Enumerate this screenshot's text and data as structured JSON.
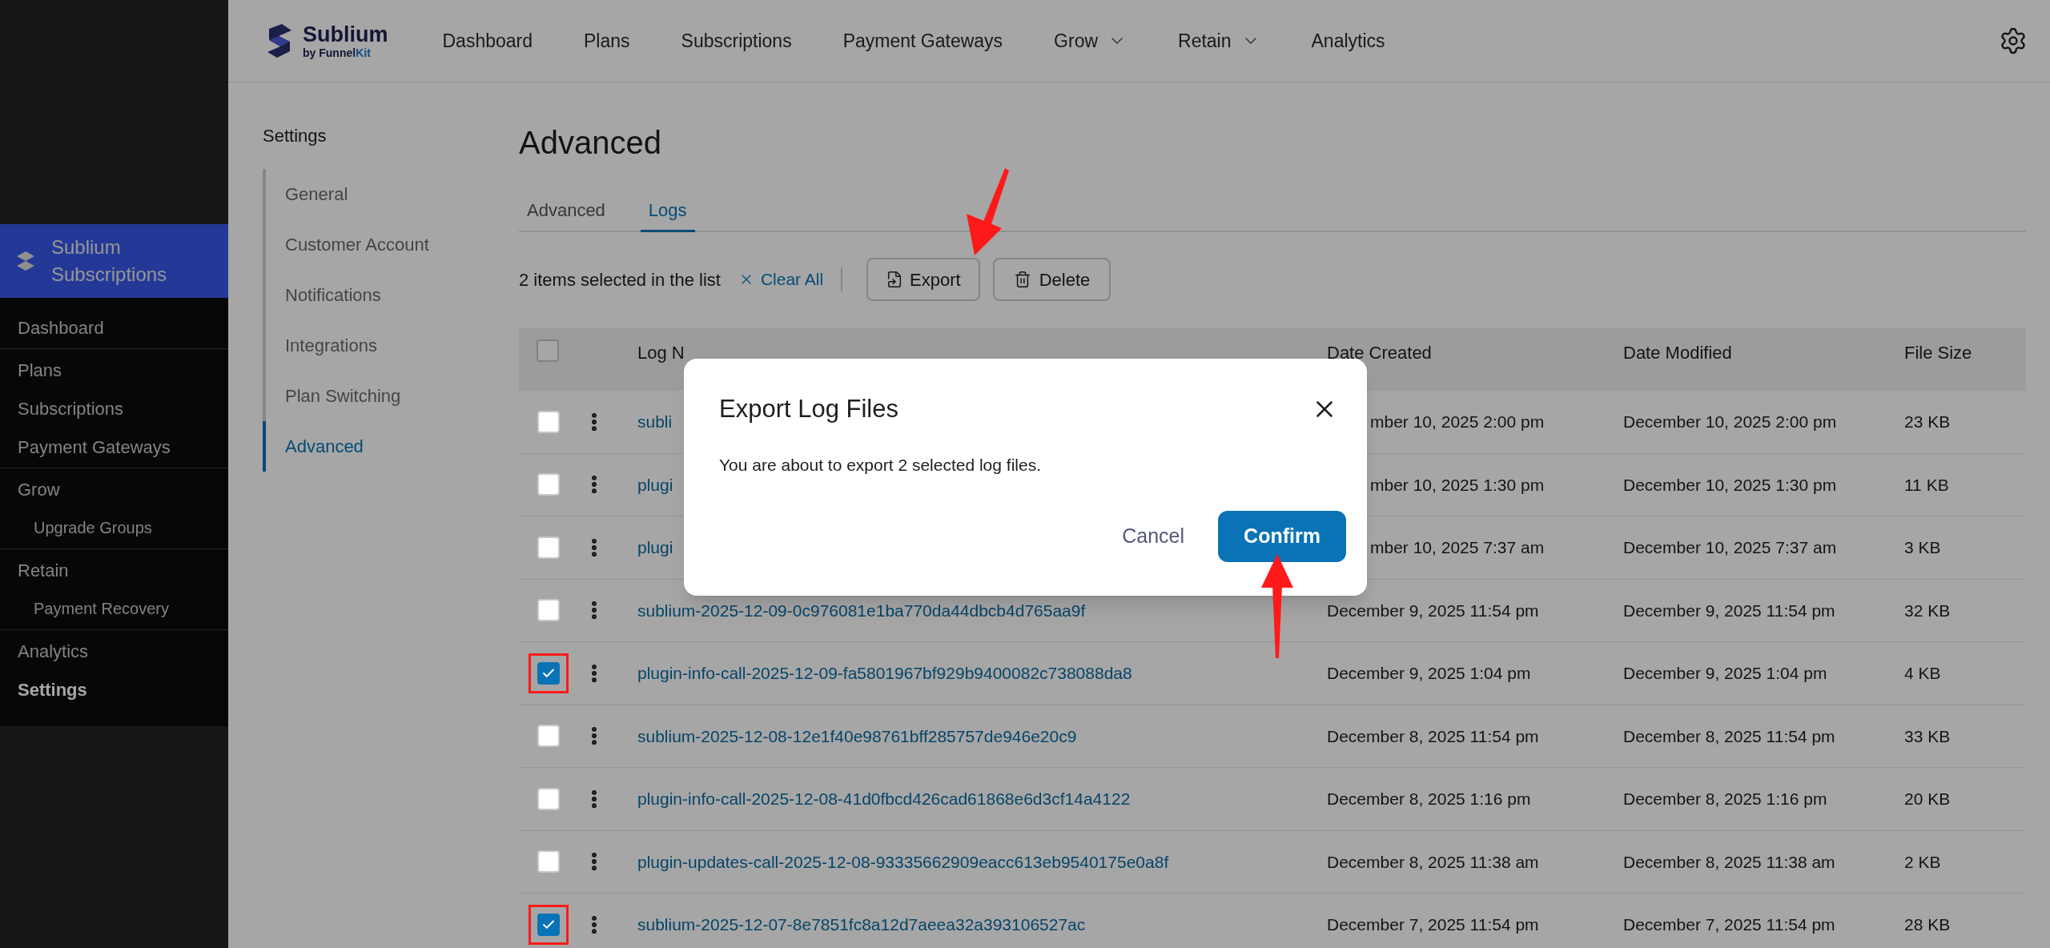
{
  "admin_menu": {
    "app": {
      "title": "Sublium Subscriptions",
      "selected": true
    },
    "groups": [
      [
        {
          "label": "Dashboard",
          "selected": false
        }
      ],
      [
        {
          "label": "Plans",
          "selected": false
        },
        {
          "label": "Subscriptions",
          "selected": false
        },
        {
          "label": "Payment Gateways",
          "selected": false
        }
      ],
      [
        {
          "label": "Grow",
          "selected": false,
          "children": [
            {
              "label": "Upgrade Groups",
              "selected": false
            }
          ]
        }
      ],
      [
        {
          "label": "Retain",
          "selected": false,
          "children": [
            {
              "label": "Payment Recovery",
              "selected": false
            }
          ]
        }
      ],
      [
        {
          "label": "Analytics",
          "selected": false
        },
        {
          "label": "Settings",
          "selected": true
        }
      ]
    ]
  },
  "top_bar": {
    "logo": {
      "name": "Sublium",
      "by": "by",
      "brand_first": "Funnel",
      "brand_second": "Kit"
    },
    "nav": [
      {
        "label": "Dashboard",
        "dropdown": false
      },
      {
        "label": "Plans",
        "dropdown": false
      },
      {
        "label": "Subscriptions",
        "dropdown": false
      },
      {
        "label": "Payment Gateways",
        "dropdown": false
      },
      {
        "label": "Grow",
        "dropdown": true
      },
      {
        "label": "Retain",
        "dropdown": true
      },
      {
        "label": "Analytics",
        "dropdown": false
      }
    ]
  },
  "settings_nav": {
    "title": "Settings",
    "items": [
      {
        "label": "General",
        "selected": false
      },
      {
        "label": "Customer Account",
        "selected": false
      },
      {
        "label": "Notifications",
        "selected": false
      },
      {
        "label": "Integrations",
        "selected": false
      },
      {
        "label": "Plan Switching",
        "selected": false
      },
      {
        "label": "Advanced",
        "selected": true
      }
    ]
  },
  "page_title": "Advanced",
  "tabs": [
    {
      "label": "Advanced",
      "selected": false
    },
    {
      "label": "Logs",
      "selected": true
    }
  ],
  "bulk_bar": {
    "text": "2 items selected in the list",
    "clear": "Clear All",
    "export": "Export",
    "delete": "Delete"
  },
  "table": {
    "select_all": false,
    "columns": [
      "Log N",
      "Date Created",
      "Date Modified",
      "File Size"
    ],
    "rows": [
      {
        "checked": false,
        "highlighted": false,
        "name": "subli",
        "created": "mber 10, 2025 2:00 pm",
        "modified": "December 10, 2025 2:00 pm",
        "size": "23 KB"
      },
      {
        "checked": false,
        "highlighted": false,
        "name": "plugi",
        "created": "mber 10, 2025 1:30 pm",
        "modified": "December 10, 2025 1:30 pm",
        "size": "11 KB"
      },
      {
        "checked": false,
        "highlighted": false,
        "name": "plugi",
        "created": "mber 10, 2025 7:37 am",
        "modified": "December 10, 2025 7:37 am",
        "size": "3 KB"
      },
      {
        "checked": false,
        "highlighted": false,
        "name": "sublium-2025-12-09-0c976081e1ba770da44dbcb4d765aa9f",
        "created": "December 9, 2025 11:54 pm",
        "modified": "December 9, 2025 11:54 pm",
        "size": "32 KB"
      },
      {
        "checked": true,
        "highlighted": true,
        "name": "plugin-info-call-2025-12-09-fa5801967bf929b9400082c738088da8",
        "created": "December 9, 2025 1:04 pm",
        "modified": "December 9, 2025 1:04 pm",
        "size": "4 KB"
      },
      {
        "checked": false,
        "highlighted": false,
        "name": "sublium-2025-12-08-12e1f40e98761bff285757de946e20c9",
        "created": "December 8, 2025 11:54 pm",
        "modified": "December 8, 2025 11:54 pm",
        "size": "33 KB"
      },
      {
        "checked": false,
        "highlighted": false,
        "name": "plugin-info-call-2025-12-08-41d0fbcd426cad61868e6d3cf14a4122",
        "created": "December 8, 2025 1:16 pm",
        "modified": "December 8, 2025 1:16 pm",
        "size": "20 KB"
      },
      {
        "checked": false,
        "highlighted": false,
        "name": "plugin-updates-call-2025-12-08-93335662909eacc613eb9540175e0a8f",
        "created": "December 8, 2025 11:38 am",
        "modified": "December 8, 2025 11:38 am",
        "size": "2 KB"
      },
      {
        "checked": true,
        "highlighted": true,
        "name": "sublium-2025-12-07-8e7851fc8a12d7aeea32a393106527ac",
        "created": "December 7, 2025 11:54 pm",
        "modified": "December 7, 2025 11:54 pm",
        "size": "28 KB"
      }
    ]
  },
  "modal": {
    "title": "Export Log Files",
    "message": "You are about to export 2 selected log files.",
    "cancel": "Cancel",
    "confirm": "Confirm"
  }
}
